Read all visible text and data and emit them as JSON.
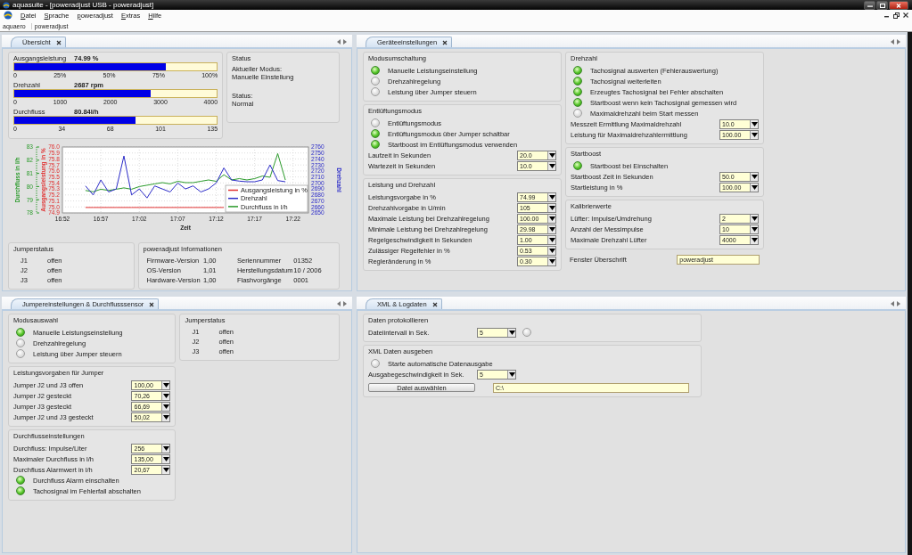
{
  "window": {
    "title": "aquasuite - [poweradjust USB - poweradjust]"
  },
  "menu": [
    {
      "label": "Datei"
    },
    {
      "label": "Sprache"
    },
    {
      "label": "poweradjust"
    },
    {
      "label": "Extras"
    },
    {
      "label": "Hilfe"
    }
  ],
  "breadcrumb": [
    "aquaero",
    "poweradjust"
  ],
  "panels": [
    {
      "kind": "overview",
      "tab": {
        "label": "Übersicht",
        "selected": true
      },
      "rows": [
        {
          "columns": [
            [
              {
                "items": [
                  {
                    "kind": "bar",
                    "label": "Ausgangsleistung",
                    "reading": "74.99 %",
                    "level": 0.75,
                    "scale": [
                      "0",
                      "25%",
                      "50%",
                      "75%",
                      "100%"
                    ]
                  },
                  {
                    "kind": "bar",
                    "label": "Drehzahl",
                    "reading": "2687 rpm",
                    "level": 0.672,
                    "scale": [
                      "0",
                      "1000",
                      "2000",
                      "3000",
                      "4000"
                    ]
                  },
                  {
                    "kind": "bar",
                    "label": "Durchfluss",
                    "reading": "80.84l/h",
                    "level": 0.599,
                    "scale": [
                      "0",
                      "34",
                      "68",
                      "101",
                      "135"
                    ]
                  }
                ]
              }
            ],
            [
              {
                "title": "Status",
                "items": [
                  {
                    "kind": "info",
                    "label": "Aktueller Modus:",
                    "value": "Manuelle Einstellung"
                  },
                  {
                    "kind": "info",
                    "label": "Status:",
                    "value": "Normal"
                  }
                ]
              }
            ]
          ]
        },
        {
          "columns": [
            [
              {
                "items": [
                  {
                    "kind": "chart",
                    "chart_data": {
                      "type": "line",
                      "xlabel": "Zeit",
                      "ylabel": "Ausgangsleistung in %",
                      "y2label": "Drehzahl",
                      "y3label": "Durchfluss in l/h",
                      "categories": [
                        "16:52",
                        null,
                        null,
                        null,
                        null,
                        "16:57",
                        null,
                        null,
                        null,
                        null,
                        "17:02",
                        null,
                        null,
                        null,
                        null,
                        "17:07",
                        null,
                        null,
                        null,
                        null,
                        "17:12",
                        null,
                        null,
                        null,
                        null,
                        "17:17",
                        null,
                        null,
                        null,
                        null,
                        "17:22"
                      ],
                      "grid": true,
                      "legend": true,
                      "ylim": [
                        74.9,
                        76.0
                      ],
                      "yticks": [
                        74.9,
                        {
                          "value": 75.0,
                          "label": "75.0"
                        },
                        75.1,
                        75.2,
                        75.3,
                        75.4,
                        75.5,
                        75.6,
                        75.7,
                        75.8,
                        75.9,
                        {
                          "value": 76.0,
                          "label": "76.0"
                        }
                      ],
                      "y2lim": [
                        2650,
                        2760
                      ],
                      "y2ticks": [
                        2650,
                        2660,
                        2670,
                        2680,
                        2690,
                        2700,
                        2710,
                        2720,
                        2730,
                        2740,
                        2750,
                        2760
                      ],
                      "y3lim": [
                        78,
                        83
                      ],
                      "y3ticks": [
                        78,
                        79,
                        80,
                        81,
                        82,
                        83
                      ],
                      "series": [
                        {
                          "name": "Ausgangsleistung in %",
                          "color": "#e03030",
                          "values": [
                            null,
                            null,
                            null,
                            74.99,
                            74.99,
                            74.99,
                            74.99,
                            74.99,
                            74.99,
                            74.99,
                            74.99,
                            74.99,
                            74.99,
                            74.99,
                            74.99,
                            74.99,
                            74.99,
                            74.99,
                            74.99,
                            74.99,
                            74.99,
                            74.99,
                            null,
                            null,
                            null,
                            null,
                            null,
                            null,
                            null,
                            null,
                            null
                          ]
                        },
                        {
                          "name": "Drehzahl",
                          "axis": "y2",
                          "color": "#2a2ac8",
                          "values": [
                            null,
                            null,
                            null,
                            2695,
                            2680,
                            2705,
                            2685,
                            2690,
                            2745,
                            2680,
                            2690,
                            2675,
                            2695,
                            2690,
                            2685,
                            2700,
                            2690,
                            2695,
                            2685,
                            2690,
                            2700,
                            2725,
                            2705,
                            2703,
                            2702,
                            2702,
                            2705,
                            2730,
                            2704,
                            2702,
                            null
                          ]
                        },
                        {
                          "name": "Durchfluss in l/h",
                          "axis": "y3",
                          "color": "#2a9a2a",
                          "values": [
                            null,
                            null,
                            null,
                            79.7,
                            79.6,
                            79.8,
                            79.7,
                            79.8,
                            79.9,
                            79.8,
                            80.0,
                            80.1,
                            80.2,
                            80.3,
                            80.2,
                            80.4,
                            80.3,
                            80.3,
                            80.4,
                            80.5,
                            80.4,
                            80.9,
                            80.5,
                            80.6,
                            80.5,
                            80.6,
                            80.8,
                            80.7,
                            82.5,
                            80.5,
                            null
                          ]
                        }
                      ]
                    }
                  }
                ]
              }
            ]
          ]
        },
        {
          "columns": [
            [
              {
                "title": "Jumperstatus",
                "items": [
                  {
                    "kind": "kv",
                    "cells": [
                      "J1",
                      "offen"
                    ]
                  },
                  {
                    "kind": "kv",
                    "cells": [
                      "J2",
                      "offen"
                    ]
                  },
                  {
                    "kind": "kv",
                    "cells": [
                      "J3",
                      "offen"
                    ]
                  }
                ]
              }
            ],
            [
              {
                "title": "poweradjust Informationen",
                "items": [
                  {
                    "kind": "kv",
                    "cells": [
                      "Firmware-Version",
                      "1,00",
                      "Seriennummer",
                      "01352"
                    ]
                  },
                  {
                    "kind": "kv",
                    "cells": [
                      "OS-Version",
                      "1,01",
                      "Herstellungsdatum",
                      "10 / 2006"
                    ]
                  },
                  {
                    "kind": "kv",
                    "cells": [
                      "Hardware-Version",
                      "1,00",
                      "Flashvorgänge",
                      "0001"
                    ]
                  }
                ]
              }
            ]
          ]
        }
      ]
    },
    {
      "kind": "device",
      "tab": {
        "label": "Geräteeinstellungen",
        "selected": true
      },
      "rows": [
        {
          "columns": [
            [
              {
                "title": "Modusumschaltung",
                "items": [
                  {
                    "kind": "radio",
                    "label": "Manuelle Leistungseinstellung",
                    "checked": true
                  },
                  {
                    "kind": "radio",
                    "label": "Drehzahlregelung",
                    "checked": false
                  },
                  {
                    "kind": "radio",
                    "label": "Leistung über Jumper steuern",
                    "checked": false
                  }
                ]
              },
              {
                "title": "Entlüftungsmodus",
                "items": [
                  {
                    "kind": "radio",
                    "label": "Entlüftungsmodus",
                    "checked": false
                  },
                  {
                    "kind": "radio",
                    "label": "Entlüftungsmodus über Jumper schaltbar",
                    "checked": true
                  },
                  {
                    "kind": "radio",
                    "label": "Startboost im Entlüftungsmodus verwenden",
                    "checked": true
                  },
                  {
                    "kind": "spin",
                    "label": "Laufzeit in Sekunden",
                    "value": "20.0"
                  },
                  {
                    "kind": "spin",
                    "label": "Wartezeit in Sekunden",
                    "value": "10.0"
                  }
                ]
              },
              {
                "title": "Leistung und Drehzahl",
                "items": [
                  {
                    "kind": "spin",
                    "label": "Leistungsvorgabe in %",
                    "value": "74.99"
                  },
                  {
                    "kind": "spin",
                    "label": "Drehzahlvorgabe in U/min",
                    "value": "105"
                  },
                  {
                    "kind": "spin",
                    "label": "Maximale Leistung bei Drehzahlregelung",
                    "value": "100.00"
                  },
                  {
                    "kind": "spin",
                    "label": "Minimale Leistung bei Drehzahlregelung",
                    "value": "29.98"
                  },
                  {
                    "kind": "spin",
                    "label": "Regelgeschwindigkeit in Sekunden",
                    "value": "1.00"
                  },
                  {
                    "kind": "spin",
                    "label": "Zulässiger Regelfehler in %",
                    "value": "0.53"
                  },
                  {
                    "kind": "spin",
                    "label": "Regleränderung in %",
                    "value": "0.30"
                  }
                ]
              }
            ],
            [
              {
                "title": "Drehzahl",
                "items": [
                  {
                    "kind": "radio",
                    "label": "Tachosignal auswerten (Fehlerauswertung)",
                    "checked": true
                  },
                  {
                    "kind": "radio",
                    "label": "Tachosignal weiterleiten",
                    "checked": true
                  },
                  {
                    "kind": "radio",
                    "label": "Erzeugtes Tachosignal bei Fehler abschalten",
                    "checked": true
                  },
                  {
                    "kind": "radio",
                    "label": "Startboost wenn kein Tachosignal gemessen wird",
                    "checked": true
                  },
                  {
                    "kind": "radio",
                    "label": "Maximaldrehzahl beim Start messen",
                    "checked": false
                  },
                  {
                    "kind": "spin",
                    "label": "Messzeit Ermittlung Maximaldrehzahl",
                    "value": "10.0"
                  },
                  {
                    "kind": "spin",
                    "label": "Leistung für Maximaldrehzahlermittlung",
                    "value": "100.00"
                  }
                ]
              },
              {
                "title": "Startboost",
                "items": [
                  {
                    "kind": "radio",
                    "label": "Startboost bei Einschalten",
                    "checked": true
                  },
                  {
                    "kind": "spin",
                    "label": "Startboost Zeit in Sekunden",
                    "value": "50.0"
                  },
                  {
                    "kind": "spin",
                    "label": "Startleistung in %",
                    "value": "100.00"
                  }
                ]
              },
              {
                "title": "Kalibrierwerte",
                "items": [
                  {
                    "kind": "spin",
                    "label": "Lüfter: Impulse/Umdrehung",
                    "value": "2"
                  },
                  {
                    "kind": "spin",
                    "label": "Anzahl der Messimpulse",
                    "value": "10"
                  },
                  {
                    "kind": "spin",
                    "label": "Maximale Drehzahl Lüfter",
                    "value": "4000"
                  }
                ]
              },
              {
                "items": [
                  {
                    "kind": "field",
                    "label": "Fenster Überschrift",
                    "value": "poweradjust"
                  }
                ]
              }
            ]
          ]
        }
      ]
    },
    {
      "kind": "jumper",
      "tab": {
        "label": "Jumpereinstellungen & Durchflusssensor",
        "selected": true
      },
      "rows": [
        {
          "columns": [
            [
              {
                "title": "Modusauswahl",
                "items": [
                  {
                    "kind": "radio",
                    "label": "Manuelle Leistungseinstellung",
                    "checked": true
                  },
                  {
                    "kind": "radio",
                    "label": "Drehzahlregelung",
                    "checked": false
                  },
                  {
                    "kind": "radio",
                    "label": "Leistung über Jumper steuern",
                    "checked": false
                  }
                ]
              },
              {
                "title": "Leistungsvorgaben für Jumper",
                "items": [
                  {
                    "kind": "spin",
                    "label": "Jumper J2 und J3 offen",
                    "value": "100,00"
                  },
                  {
                    "kind": "spin",
                    "label": "Jumper J2 gesteckt",
                    "value": "70,26"
                  },
                  {
                    "kind": "spin",
                    "label": "Jumper J3 gesteckt",
                    "value": "66,69"
                  },
                  {
                    "kind": "spin",
                    "label": "Jumper J2 und J3 gesteckt",
                    "value": "50,02"
                  }
                ]
              },
              {
                "title": "Durchflusseinstellungen",
                "items": [
                  {
                    "kind": "spin",
                    "label": "Durchfluss: Impulse/Liter",
                    "value": "256"
                  },
                  {
                    "kind": "spin",
                    "label": "Maximaler Durchfluss in l/h",
                    "value": "135,00"
                  },
                  {
                    "kind": "spin",
                    "label": "Durchfluss Alarmwert in l/h",
                    "value": "20,67"
                  },
                  {
                    "kind": "radio",
                    "label": "Durchfluss Alarm einschalten",
                    "checked": true
                  },
                  {
                    "kind": "radio",
                    "label": "Tachosignal im Fehlerfall abschalten",
                    "checked": true
                  }
                ]
              }
            ],
            [
              {
                "title": "Jumperstatus",
                "items": [
                  {
                    "kind": "kv",
                    "cells": [
                      "J1",
                      "offen"
                    ]
                  },
                  {
                    "kind": "kv",
                    "cells": [
                      "J2",
                      "offen"
                    ]
                  },
                  {
                    "kind": "kv",
                    "cells": [
                      "J3",
                      "offen"
                    ]
                  }
                ]
              }
            ]
          ]
        }
      ]
    },
    {
      "kind": "xml",
      "tab": {
        "label": "XML & Logdaten",
        "selected": true
      },
      "rows": [
        {
          "columns": [
            [
              {
                "title": "Daten protokollieren",
                "items": [
                  {
                    "kind": "spin-toggle",
                    "label": "Dateiintervall in Sek.",
                    "value": "5",
                    "checked": false
                  }
                ]
              },
              {
                "title": "XML Daten ausgeben",
                "items": [
                  {
                    "kind": "radio",
                    "label": "Starte automatische Datenausgabe",
                    "checked": false
                  },
                  {
                    "kind": "spin",
                    "label": "Ausgabegeschwindigkeit in Sek.",
                    "value": "5"
                  },
                  {
                    "kind": "file",
                    "button": "Datei auswählen",
                    "value": "C:\\"
                  }
                ]
              }
            ]
          ]
        }
      ]
    }
  ]
}
